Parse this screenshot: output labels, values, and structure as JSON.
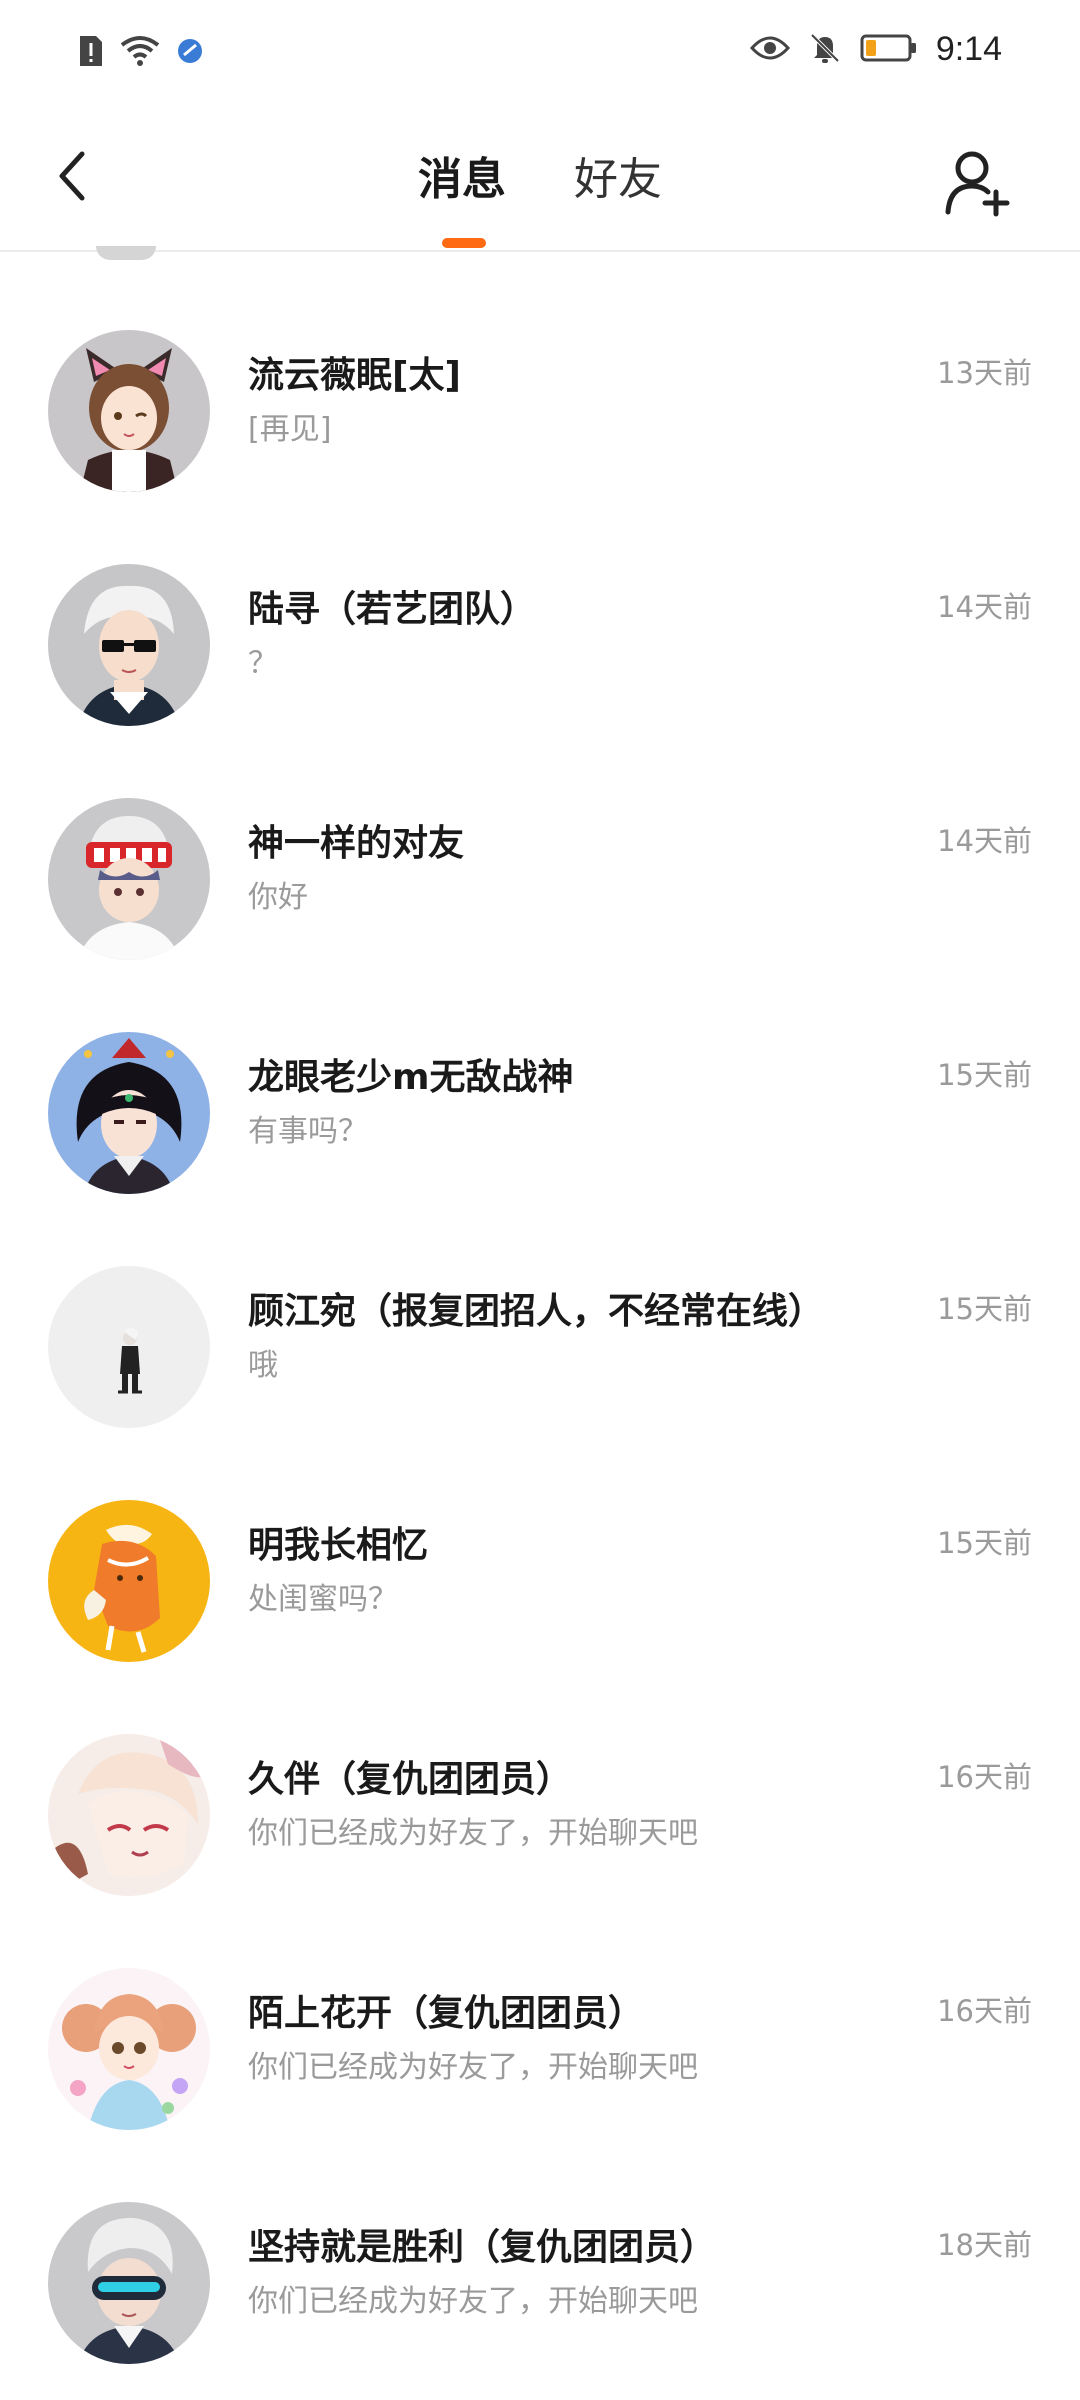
{
  "status_bar": {
    "time": "9:14",
    "left_icons": [
      "sim-alert-icon",
      "wifi-icon",
      "app-notification-icon"
    ],
    "right_icons": [
      "eye-icon",
      "bell-off-icon",
      "battery-icon"
    ],
    "battery_level": 0.25
  },
  "header": {
    "back_icon": "chevron-left-icon",
    "tabs": [
      {
        "label": "消息",
        "active": true
      },
      {
        "label": "好友",
        "active": false
      }
    ],
    "add_friend_icon": "add-user-icon",
    "accent_color": "#ff6a13"
  },
  "conversations": [
    {
      "name": "流云薇眠[太]",
      "preview": "[再见]",
      "time": "13天前",
      "avatar": "cat-ear-girl-avatar"
    },
    {
      "name": "陆寻（若艺团队）",
      "preview": "？",
      "time": "14天前",
      "avatar": "sunglasses-boy-avatar"
    },
    {
      "name": "神一样的对友",
      "preview": "你好",
      "time": "14天前",
      "avatar": "headband-boy-avatar"
    },
    {
      "name": "龙眼老少m无敌战神",
      "preview": "有事吗？",
      "time": "15天前",
      "avatar": "dark-hair-warrior-avatar"
    },
    {
      "name": "顾江宛（报复团招人，不经常在线）",
      "preview": "哦",
      "time": "15天前",
      "avatar": "small-figure-avatar"
    },
    {
      "name": "明我长相忆",
      "preview": "处闺蜜吗？",
      "time": "15天前",
      "avatar": "orange-anime-avatar"
    },
    {
      "name": "久伴（复仇团团员）",
      "preview": "你们已经成为好友了，开始聊天吧",
      "time": "16天前",
      "avatar": "white-hair-anime-avatar"
    },
    {
      "name": "陌上花开（复仇团团员）",
      "preview": "你们已经成为好友了，开始聊天吧",
      "time": "16天前",
      "avatar": "pigtail-girl-avatar"
    },
    {
      "name": "坚持就是胜利（复仇团团员）",
      "preview": "你们已经成为好友了，开始聊天吧",
      "time": "18天前",
      "avatar": "visor-boy-avatar"
    }
  ]
}
